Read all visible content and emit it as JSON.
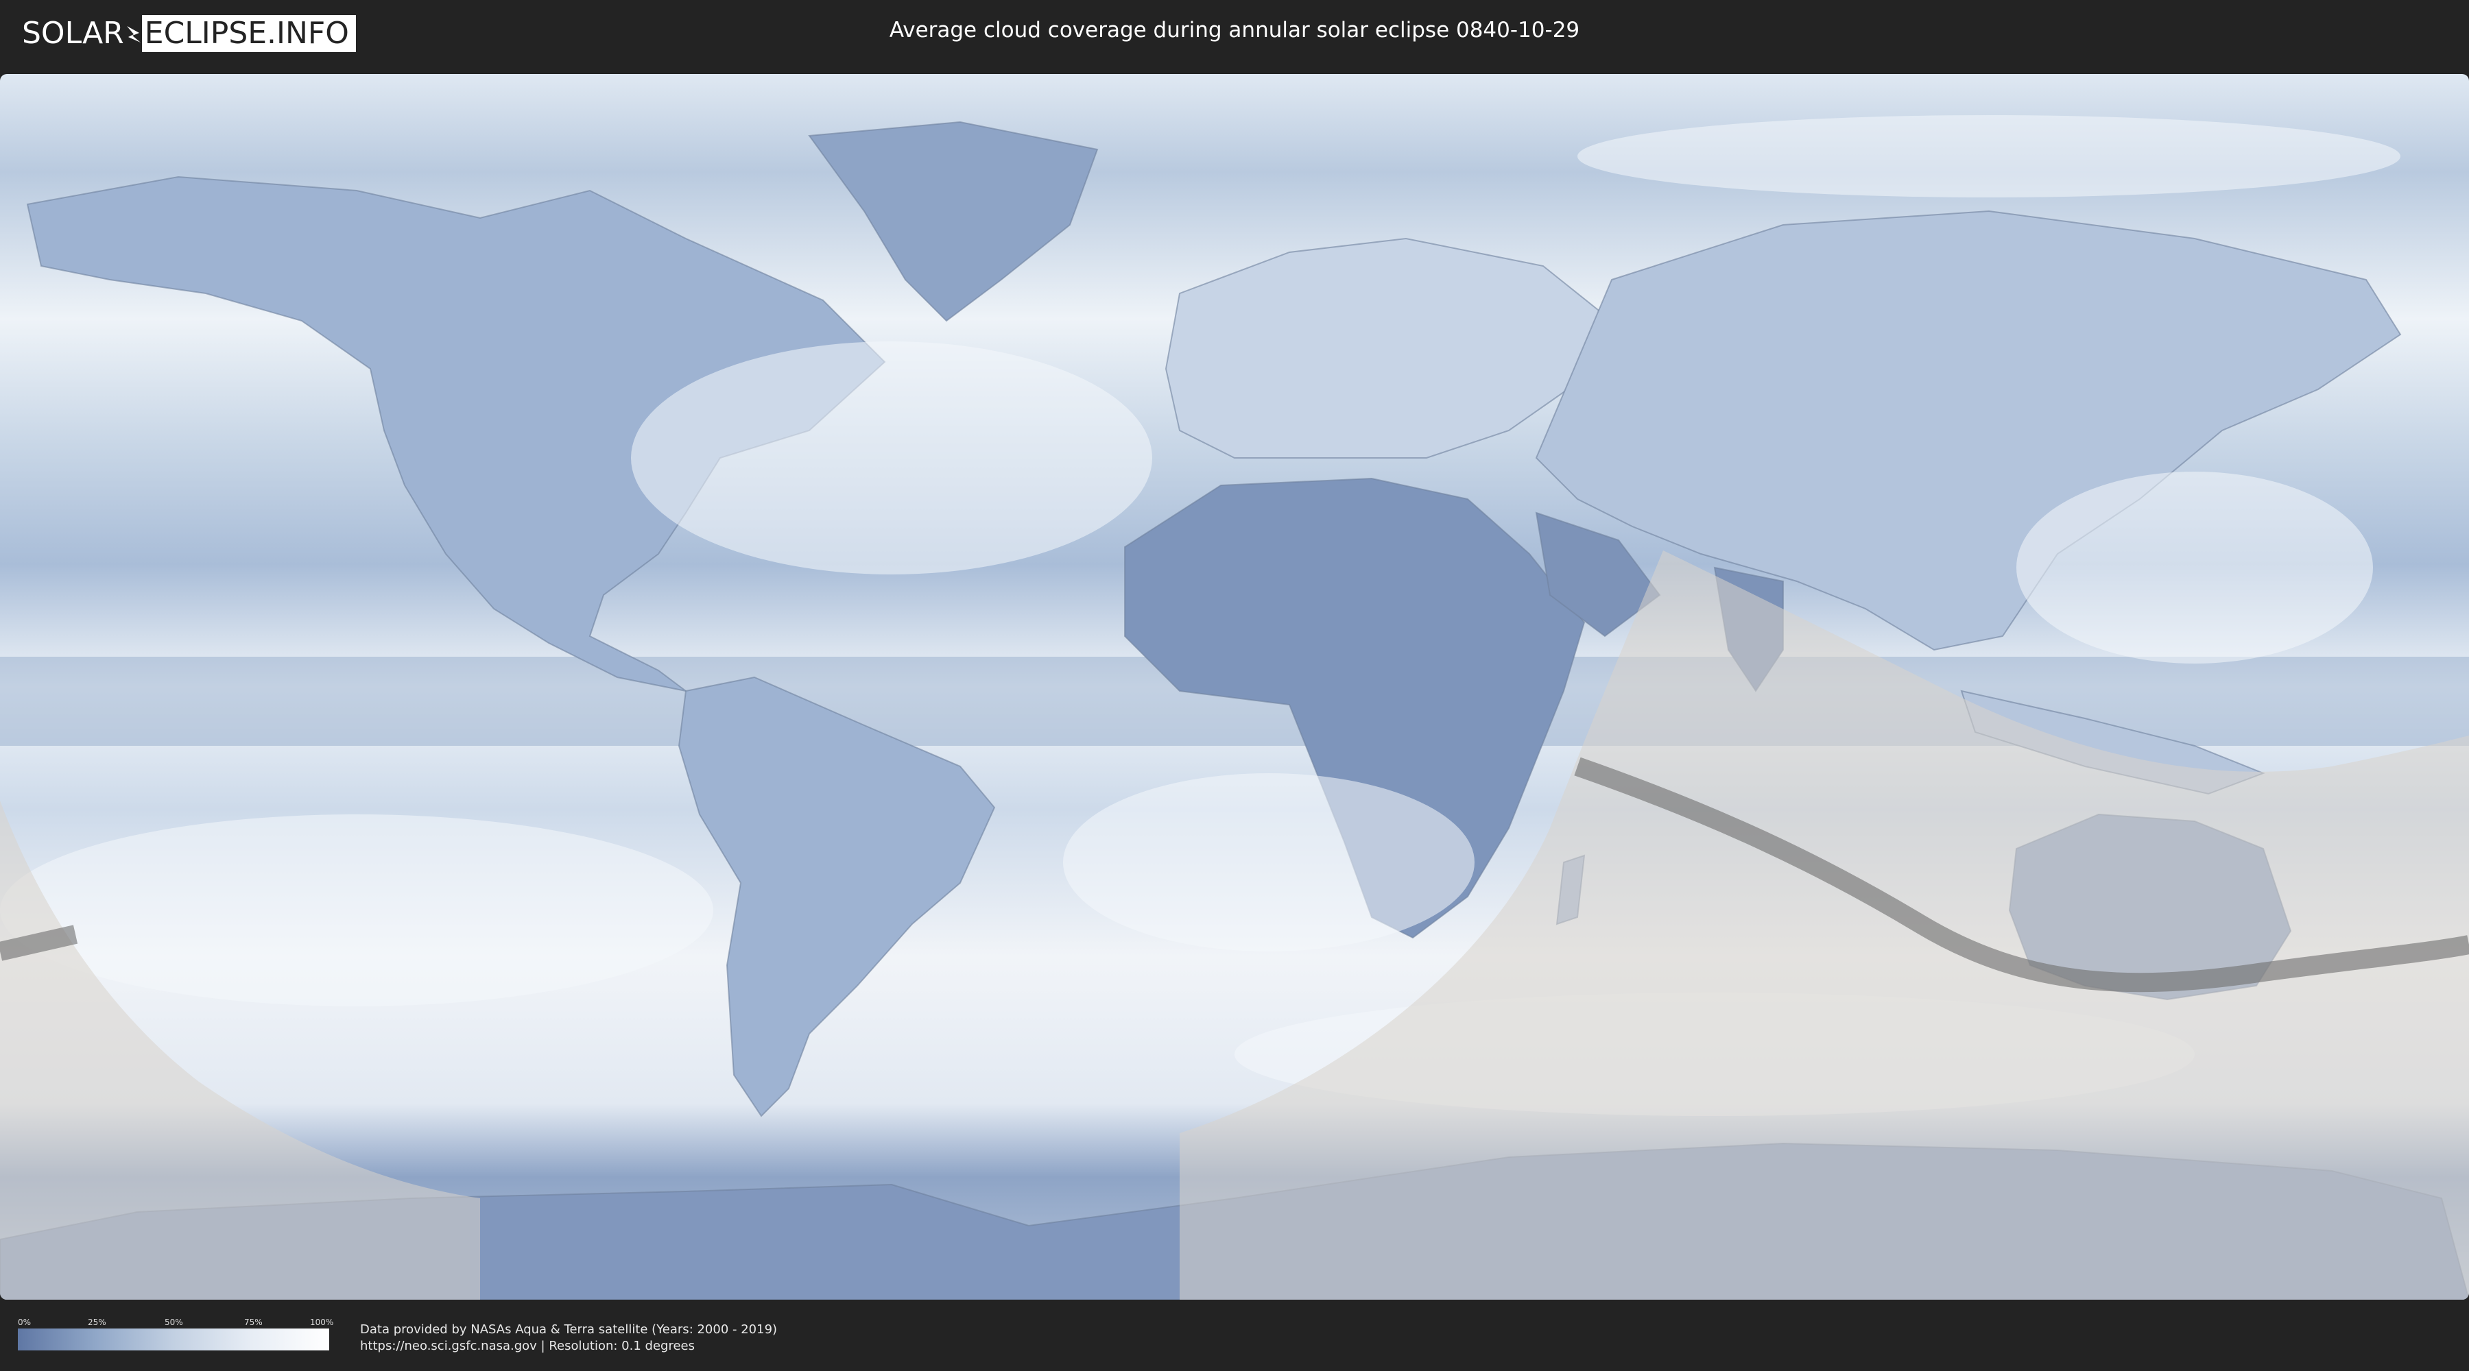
{
  "header": {
    "logo_left": "SOLAR",
    "logo_right": "ECLIPSE.INFO",
    "title": "Average cloud coverage during annular solar eclipse 0840-10-29"
  },
  "map": {
    "projection": "equirectangular",
    "layer": "average cloud coverage",
    "eclipse_type": "annular",
    "eclipse_date": "0840-10-29",
    "colors": {
      "clear": "#5f77a4",
      "cloudy": "#ffffff",
      "penumbra_shade": "#d8d4cc",
      "central_path": "#6e6e6e"
    }
  },
  "legend": {
    "labels": [
      "0%",
      "25%",
      "50%",
      "75%",
      "100%"
    ],
    "gradient_colors": [
      "#5f77a4",
      "#90a7c8",
      "#c2d0e2",
      "#e7edf5",
      "#ffffff"
    ]
  },
  "footer": {
    "credit_line1": "Data provided by NASAs Aqua & Terra satellite (Years: 2000 - 2019)",
    "credit_line2": "https://neo.sci.gsfc.nasa.gov | Resolution: 0.1 degrees"
  }
}
